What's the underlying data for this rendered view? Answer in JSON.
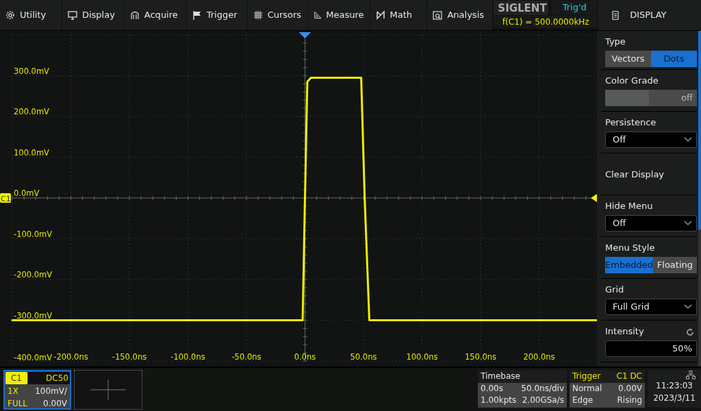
{
  "toolbar": [
    {
      "label": "Utility"
    },
    {
      "label": "Display"
    },
    {
      "label": "Acquire"
    },
    {
      "label": "Trigger"
    },
    {
      "label": "Cursors"
    },
    {
      "label": "Measure"
    },
    {
      "label": "Math"
    },
    {
      "label": "Analysis"
    }
  ],
  "brand": "SIGLENT",
  "trigger_status": "Trig'd",
  "frequency": "f(C1) = 500.0000kHz",
  "menu": {
    "title": "DISPLAY",
    "items": [
      {
        "kind": "segmented",
        "label": "Type",
        "options": [
          {
            "label": "Vectors",
            "selected": false
          },
          {
            "label": "Dots",
            "selected": true
          }
        ]
      },
      {
        "kind": "toggle",
        "label": "Color Grade",
        "value": "off",
        "on": false
      },
      {
        "kind": "dropdown",
        "label": "Persistence",
        "value": "Off"
      },
      {
        "kind": "action",
        "label": "Clear Display"
      },
      {
        "kind": "dropdown",
        "label": "Hide Menu",
        "value": "Off"
      },
      {
        "kind": "segmented",
        "label": "Menu Style",
        "options": [
          {
            "label": "Embedded",
            "selected": true
          },
          {
            "label": "Floating",
            "selected": false
          }
        ]
      },
      {
        "kind": "dropdown",
        "label": "Grid",
        "value": "Full Grid"
      },
      {
        "kind": "input",
        "label": "Intensity",
        "value": "50%"
      }
    ]
  },
  "plot": {
    "chart_data": {
      "type": "line",
      "grid": true,
      "x": [
        -250,
        -2,
        0,
        2,
        5,
        48,
        51,
        55,
        250
      ],
      "series": [
        {
          "name": "C1",
          "color": "#f0f000",
          "values": [
            -300,
            -300,
            0,
            285,
            295,
            295,
            0,
            -300,
            -300
          ]
        }
      ],
      "xlim": [
        -250,
        250
      ],
      "ylim": [
        -400,
        400
      ],
      "xticks": [
        {
          "value": -200,
          "label": "-200.0ns"
        },
        {
          "value": -150,
          "label": "-150.0ns"
        },
        {
          "value": -100,
          "label": "-100.0ns"
        },
        {
          "value": -50,
          "label": "-50.0ns"
        },
        {
          "value": 0,
          "label": "0.0ns"
        },
        {
          "value": 50,
          "label": "50.0ns"
        },
        {
          "value": 100,
          "label": "100.0ns"
        },
        {
          "value": 150,
          "label": "150.0ns"
        },
        {
          "value": 200,
          "label": "200.0ns"
        }
      ],
      "yticks": [
        {
          "value": 300,
          "label": "300.0mV"
        },
        {
          "value": 200,
          "label": "200.0mV"
        },
        {
          "value": 100,
          "label": "100.0mV"
        },
        {
          "value": 0,
          "label": "0.0mV"
        },
        {
          "value": -100,
          "label": "-100.0mV"
        },
        {
          "value": -200,
          "label": "-200.0mV"
        },
        {
          "value": -300,
          "label": "-300.0mV"
        },
        {
          "value": -400,
          "label": "-400.0mV"
        }
      ]
    }
  },
  "channel": {
    "name": "C1",
    "coupling": "DC50",
    "probe": "1X",
    "scale": "100mV/",
    "bandwidth": "FULL",
    "offset": "0.00V",
    "selected": true
  },
  "timebase": {
    "title": "Timebase",
    "delay": "0.00s",
    "scale": "50.0ns/div",
    "memory": "1.00kpts",
    "sample_rate": "2.00GSa/s"
  },
  "trigger": {
    "title": "Trigger",
    "source": "C1",
    "coupling": "DC",
    "mode": "Normal",
    "level": "0.00V",
    "type": "Edge",
    "slope": "Rising"
  },
  "clock": {
    "time": "11:23:03",
    "date": "2023/3/11"
  }
}
